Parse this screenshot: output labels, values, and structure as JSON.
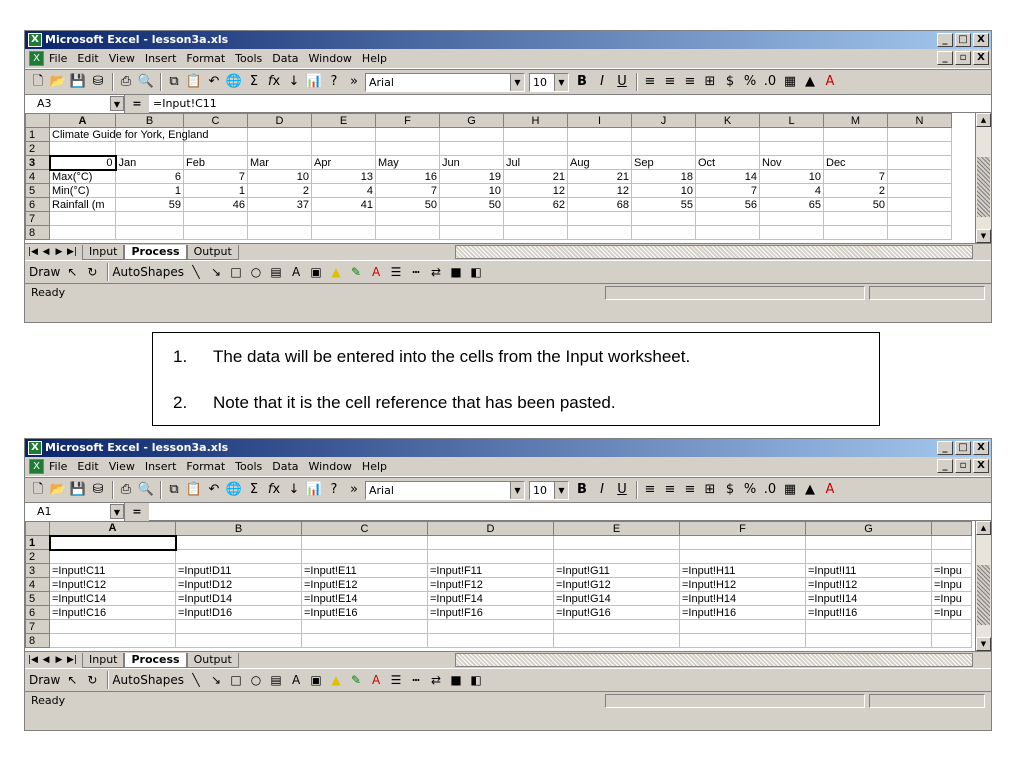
{
  "title": "Microsoft Excel - lesson3a.xls",
  "menu": [
    "File",
    "Edit",
    "View",
    "Insert",
    "Format",
    "Tools",
    "Data",
    "Window",
    "Help"
  ],
  "toolbar": {
    "font": "Arial",
    "size": "10",
    "bold": "B",
    "italic": "I",
    "underline": "U"
  },
  "window_buttons": [
    "_",
    "□",
    "X"
  ],
  "sheet_tabs": [
    "Input",
    "Process",
    "Output"
  ],
  "draw_toolbar": {
    "draw": "Draw",
    "autoshapes": "AutoShapes"
  },
  "status": "Ready",
  "screen1": {
    "namebox": "A3",
    "formula": "=Input!C11",
    "columns": [
      "A",
      "B",
      "C",
      "D",
      "E",
      "F",
      "G",
      "H",
      "I",
      "J",
      "K",
      "L",
      "M",
      "N"
    ],
    "rows": [
      {
        "n": "1",
        "cells": [
          "Climate Guide for York, England",
          "",
          "",
          "",
          "",
          "",
          "",
          "",
          "",
          "",
          "",
          "",
          "",
          ""
        ]
      },
      {
        "n": "2",
        "cells": [
          "",
          "",
          "",
          "",
          "",
          "",
          "",
          "",
          "",
          "",
          "",
          "",
          "",
          ""
        ]
      },
      {
        "n": "3",
        "cells": [
          "0",
          "Jan",
          "Feb",
          "Mar",
          "Apr",
          "May",
          "Jun",
          "Jul",
          "Aug",
          "Sep",
          "Oct",
          "Nov",
          "Dec",
          ""
        ]
      },
      {
        "n": "4",
        "cells": [
          "Max(°C)",
          "6",
          "7",
          "10",
          "13",
          "16",
          "19",
          "21",
          "21",
          "18",
          "14",
          "10",
          "7",
          ""
        ]
      },
      {
        "n": "5",
        "cells": [
          "Min(°C)",
          "1",
          "1",
          "2",
          "4",
          "7",
          "10",
          "12",
          "12",
          "10",
          "7",
          "4",
          "2",
          ""
        ]
      },
      {
        "n": "6",
        "cells": [
          "Rainfall (m",
          "59",
          "46",
          "37",
          "41",
          "50",
          "50",
          "62",
          "68",
          "55",
          "56",
          "65",
          "50",
          ""
        ]
      },
      {
        "n": "7",
        "cells": [
          "",
          "",
          "",
          "",
          "",
          "",
          "",
          "",
          "",
          "",
          "",
          "",
          "",
          ""
        ]
      },
      {
        "n": "8",
        "cells": [
          "",
          "",
          "",
          "",
          "",
          "",
          "",
          "",
          "",
          "",
          "",
          "",
          "",
          ""
        ]
      }
    ]
  },
  "notes": [
    {
      "num": "1.",
      "text": "The data will be entered into the cells from the Input worksheet."
    },
    {
      "num": "2.",
      "text": "Note that it is the cell reference that has been pasted."
    }
  ],
  "screen2": {
    "namebox": "A1",
    "formula": "",
    "columns": [
      "A",
      "B",
      "C",
      "D",
      "E",
      "F",
      "G"
    ],
    "rows": [
      {
        "n": "1",
        "cells": [
          "",
          "",
          "",
          "",
          "",
          "",
          "",
          ""
        ]
      },
      {
        "n": "2",
        "cells": [
          "",
          "",
          "",
          "",
          "",
          "",
          "",
          ""
        ]
      },
      {
        "n": "3",
        "cells": [
          "=Input!C11",
          "=Input!D11",
          "=Input!E11",
          "=Input!F11",
          "=Input!G11",
          "=Input!H11",
          "=Input!I11",
          "=Inpu"
        ]
      },
      {
        "n": "4",
        "cells": [
          "=Input!C12",
          "=Input!D12",
          "=Input!E12",
          "=Input!F12",
          "=Input!G12",
          "=Input!H12",
          "=Input!I12",
          "=Inpu"
        ]
      },
      {
        "n": "5",
        "cells": [
          "=Input!C14",
          "=Input!D14",
          "=Input!E14",
          "=Input!F14",
          "=Input!G14",
          "=Input!H14",
          "=Input!I14",
          "=Inpu"
        ]
      },
      {
        "n": "6",
        "cells": [
          "=Input!C16",
          "=Input!D16",
          "=Input!E16",
          "=Input!F16",
          "=Input!G16",
          "=Input!H16",
          "=Input!I16",
          "=Inpu"
        ]
      },
      {
        "n": "7",
        "cells": [
          "",
          "",
          "",
          "",
          "",
          "",
          "",
          ""
        ]
      },
      {
        "n": "8",
        "cells": [
          "",
          "",
          "",
          "",
          "",
          "",
          "",
          ""
        ]
      }
    ]
  }
}
